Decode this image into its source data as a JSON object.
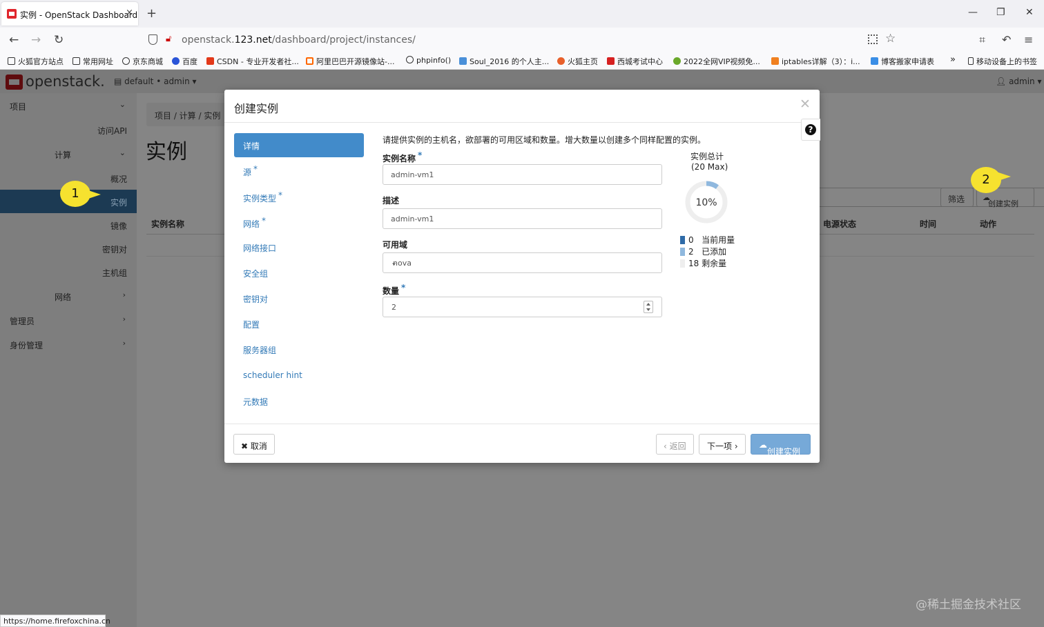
{
  "browser": {
    "tab_title": "实例 - OpenStack Dashboard",
    "tab_close": "×",
    "new_tab": "+",
    "window_controls": [
      "—",
      "❐",
      "✕"
    ],
    "url_prefix": "openstack.",
    "url_domain": "123.net",
    "url_path": "/dashboard/project/instances/",
    "back": "←",
    "forward": "→",
    "reload": "↻",
    "right_icons": [
      "⌗",
      "↶",
      "≡"
    ],
    "bookmarks": [
      {
        "label": "火狐官方站点",
        "icon": "folder-icon"
      },
      {
        "label": "常用网址",
        "icon": "folder-icon"
      },
      {
        "label": "京东商城",
        "icon": "globe-icon"
      },
      {
        "label": "百度",
        "icon": "paw-icon"
      },
      {
        "label": "CSDN - 专业开发者社...",
        "icon": "csdn-icon"
      },
      {
        "label": "阿里巴巴开源镜像站-...",
        "icon": "aliyun-icon"
      },
      {
        "label": "phpinfo()",
        "icon": "globe-icon"
      },
      {
        "label": "Soul_2016 的个人主...",
        "icon": "bird-icon"
      },
      {
        "label": "火狐主页",
        "icon": "firefox-icon"
      },
      {
        "label": "西城考试中心",
        "icon": "flag-icon"
      },
      {
        "label": "2022全网VIP视频免...",
        "icon": "circle-icon"
      },
      {
        "label": "iptables详解（3）：i...",
        "icon": "ip-icon"
      },
      {
        "label": "博客搬家申请表",
        "icon": "chart-icon"
      },
      {
        "label": "»",
        "icon": "overflow-icon"
      },
      {
        "label": "移动设备上的书签",
        "icon": "mobile-icon"
      }
    ],
    "status_url": "https://home.firefoxchina.cn"
  },
  "dashboard": {
    "logo": "openstack.",
    "project_selector": "default • admin ▾",
    "user_menu": "admin ▾",
    "sidebar": {
      "project": "项目",
      "access_api": "访问API",
      "compute": "计算",
      "overview": "概况",
      "instances": "实例",
      "images": "镜像",
      "keypairs": "密钥对",
      "server_groups": "主机组",
      "network": "网络",
      "admin": "管理员",
      "identity": "身份管理"
    },
    "breadcrumb": "项目 /  计算 /  实例",
    "page_title": "实例",
    "filter_button": "筛选",
    "create_button": "创建实例",
    "columns": {
      "instance_name": "实例名称",
      "power_state": "电源状态",
      "time": "时间",
      "actions": "动作"
    },
    "callouts": [
      "1",
      "2"
    ],
    "watermark": "@稀土掘金技术社区"
  },
  "modal": {
    "title": "创建实例",
    "close": "✕",
    "help": "?",
    "nav": [
      {
        "label": "详情",
        "required": false,
        "active": true
      },
      {
        "label": "源",
        "required": true
      },
      {
        "label": "实例类型",
        "required": true
      },
      {
        "label": "网络",
        "required": true
      },
      {
        "label": "网络接口",
        "required": false
      },
      {
        "label": "安全组",
        "required": false
      },
      {
        "label": "密钥对",
        "required": false
      },
      {
        "label": "配置",
        "required": false
      },
      {
        "label": "服务器组",
        "required": false
      },
      {
        "label": "scheduler hint",
        "required": false
      },
      {
        "label": "元数据",
        "required": false
      }
    ],
    "description": "请提供实例的主机名，欲部署的可用区域和数量。增大数量以创建多个同样配置的实例。",
    "required_mark": "*",
    "fields": {
      "name_label": "实例名称",
      "name_value": "admin-vm1",
      "desc_label": "描述",
      "desc_value": "admin-vm1",
      "az_label": "可用域",
      "az_value": "nova",
      "count_label": "数量",
      "count_value": "2"
    },
    "quota": {
      "title": "实例总计",
      "subtitle": "(20 Max)",
      "percent": "10%",
      "percent_value": 10,
      "used": {
        "value": "0",
        "label": "当前用量",
        "color": "#2f6ba8"
      },
      "added": {
        "value": "2",
        "label": "已添加",
        "color": "#8fb8de"
      },
      "remaining": {
        "value": "18",
        "label": "剩余量",
        "color": "#eeeeee"
      }
    },
    "footer": {
      "cancel": "✖ 取消",
      "back": "‹ 返回",
      "next": "下一项 ›",
      "create": "创建实例"
    }
  }
}
